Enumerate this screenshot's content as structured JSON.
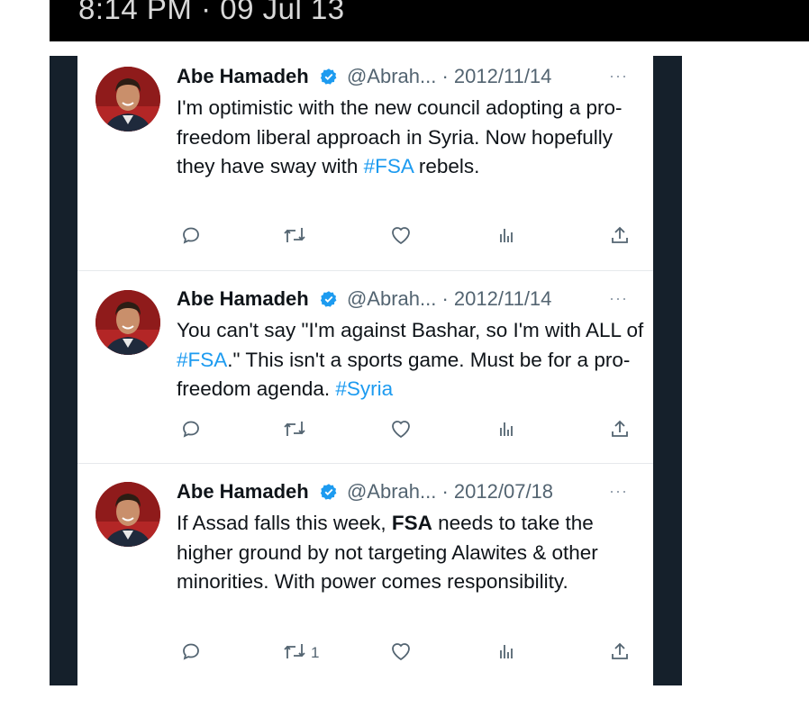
{
  "header": {
    "timestamp": "8:14 PM · 09 Jul 13"
  },
  "colors": {
    "link": "#1d9bf0",
    "muted": "#536471",
    "frame": "#15202b",
    "verified": "#1d9bf0"
  },
  "tweets": [
    {
      "name": "Abe Hamadeh",
      "handle": "@Abrah...",
      "sep": " · ",
      "date": "2012/11/14",
      "more": "···",
      "text": [
        {
          "t": "I'm optimistic with the new council adopting a pro-freedom liberal approach in Syria. Now hopefully they have sway with ",
          "s": "plain"
        },
        {
          "t": "#FSA",
          "s": "tag"
        },
        {
          "t": " rebels.",
          "s": "plain"
        }
      ],
      "actions": {
        "reply": "",
        "retweet": "",
        "like": "",
        "views": "",
        "share": ""
      }
    },
    {
      "name": "Abe Hamadeh",
      "handle": "@Abrah...",
      "sep": " · ",
      "date": "2012/11/14",
      "more": "···",
      "text": [
        {
          "t": "You can't say \"I'm against Bashar, so I'm with ALL of ",
          "s": "plain"
        },
        {
          "t": "#FSA",
          "s": "tag"
        },
        {
          "t": ".\" This isn't a sports game. Must be for a pro-freedom agenda. ",
          "s": "plain"
        },
        {
          "t": "#Syria",
          "s": "tag"
        }
      ],
      "actions": {
        "reply": "",
        "retweet": "",
        "like": "",
        "views": "",
        "share": ""
      }
    },
    {
      "name": "Abe Hamadeh",
      "handle": "@Abrah...",
      "sep": " · ",
      "date": "2012/07/18",
      "more": "···",
      "text": [
        {
          "t": "If Assad falls this week, ",
          "s": "plain"
        },
        {
          "t": "FSA",
          "s": "bold"
        },
        {
          "t": " needs to take the higher ground by not targeting Alawites & other minorities. With power comes responsibility.",
          "s": "plain"
        }
      ],
      "actions": {
        "reply": "",
        "retweet": "1",
        "like": "",
        "views": "",
        "share": ""
      }
    }
  ]
}
